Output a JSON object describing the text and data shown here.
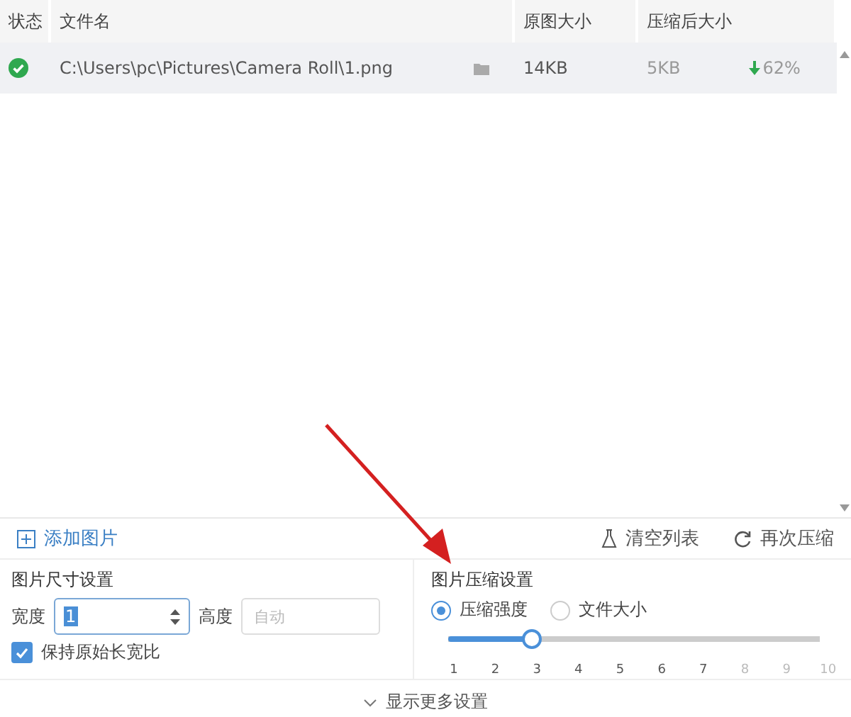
{
  "table": {
    "columns": [
      "状态",
      "文件名",
      "原图大小",
      "压缩后大小"
    ],
    "rows": [
      {
        "completed": true,
        "file": "C:\\Users\\pc\\Pictures\\Camera Roll\\1.png",
        "original": "14KB",
        "compressed": "5KB",
        "saving": "62%",
        "selected": true
      }
    ]
  },
  "toolbar": {
    "add": "添加图片",
    "clear": "清空列表",
    "recompress": "再次压缩"
  },
  "size_settings": {
    "title": "图片尺寸设置",
    "width_label": "宽度",
    "width_value": "1",
    "height_label": "高度",
    "height_placeholder": "自动",
    "keep_ratio": {
      "label": "保持原始长宽比",
      "checked": true
    }
  },
  "compress_settings": {
    "title": "图片压缩设置",
    "modes": [
      {
        "label": "压缩强度",
        "selected": true
      },
      {
        "label": "文件大小",
        "selected": false
      }
    ],
    "slider": {
      "level": 0.222,
      "ticks": [
        "1",
        "2",
        "3",
        "4",
        "5",
        "6",
        "7",
        "8",
        "9",
        "10"
      ]
    }
  },
  "more": "显示更多设置"
}
